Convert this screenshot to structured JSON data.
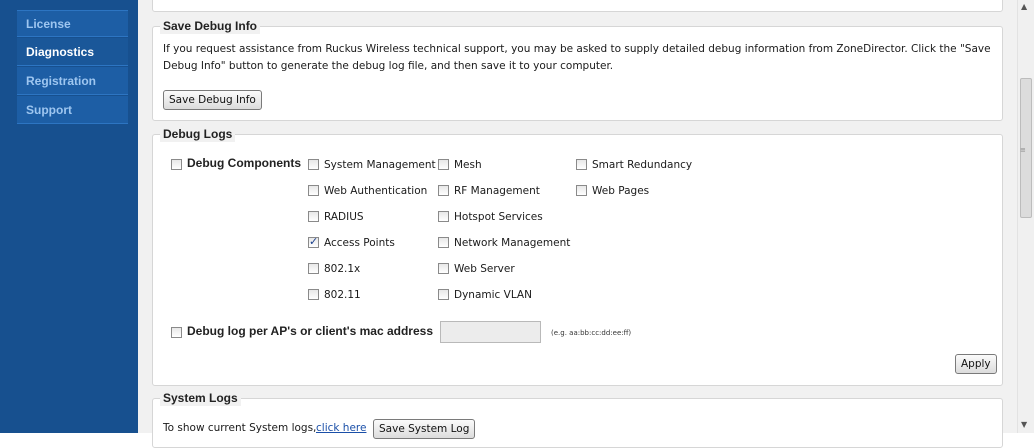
{
  "sidebar": {
    "items": [
      {
        "label": "License",
        "active": false
      },
      {
        "label": "Diagnostics",
        "active": true
      },
      {
        "label": "Registration",
        "active": false
      },
      {
        "label": "Support",
        "active": false
      }
    ]
  },
  "save_debug": {
    "legend": "Save Debug Info",
    "description": "If you request assistance from Ruckus Wireless technical support, you may be asked to supply detailed debug information from ZoneDirector. Click the \"Save Debug Info\" button to generate the debug log file, and then save it to your computer.",
    "button_label": "Save Debug Info"
  },
  "debug_logs": {
    "legend": "Debug Logs",
    "components_label": "Debug Components",
    "components": [
      {
        "label": "System Management",
        "checked": false
      },
      {
        "label": "Mesh",
        "checked": false
      },
      {
        "label": "Smart Redundancy",
        "checked": false
      },
      {
        "label": "Web Authentication",
        "checked": false
      },
      {
        "label": "RF Management",
        "checked": false
      },
      {
        "label": "Web Pages",
        "checked": false
      },
      {
        "label": "RADIUS",
        "checked": false
      },
      {
        "label": "Hotspot Services",
        "checked": false
      },
      {
        "label": "Access Points",
        "checked": true
      },
      {
        "label": "Network Management",
        "checked": false
      },
      {
        "label": "802.1x",
        "checked": false
      },
      {
        "label": "Web Server",
        "checked": false
      },
      {
        "label": "802.11",
        "checked": false
      },
      {
        "label": "Dynamic VLAN",
        "checked": false
      }
    ],
    "mac_label": "Debug log per AP's or client's mac address",
    "mac_value": "",
    "mac_hint": "(e.g. aa:bb:cc:dd:ee:ff)",
    "apply_label": "Apply"
  },
  "system_logs": {
    "legend": "System Logs",
    "text_prefix": "To show current System logs, ",
    "link_label": "click here",
    "button_label": "Save System Log"
  }
}
